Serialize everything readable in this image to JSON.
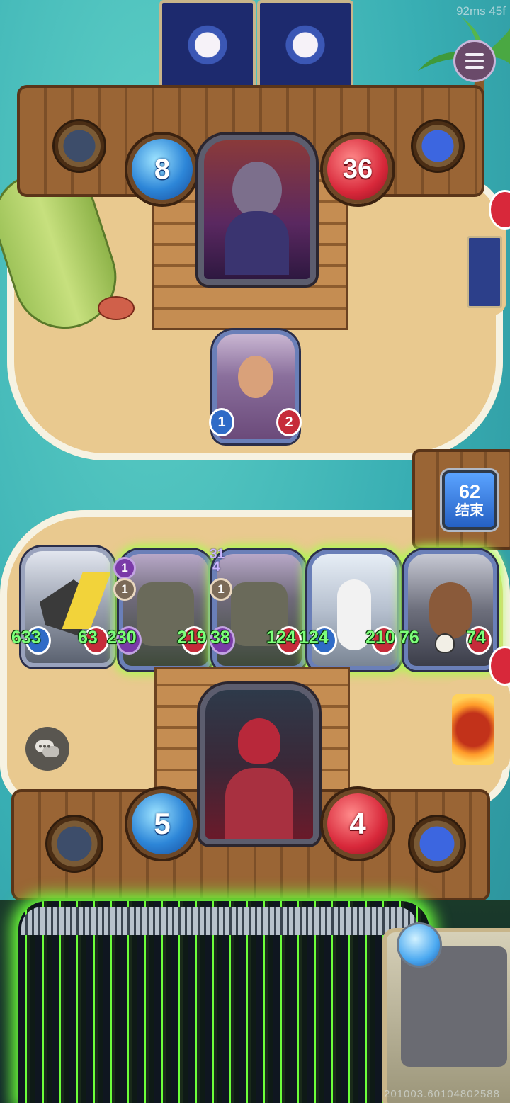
{
  "hud": {
    "debug_text": "92ms 45f",
    "build_text": "201003.60104802588",
    "end_turn": {
      "timer": "62",
      "label": "结束"
    }
  },
  "opponent": {
    "mana": "8",
    "health": "36",
    "minion": {
      "attack": "1",
      "health": "2"
    }
  },
  "player": {
    "mana": "5",
    "health": "4",
    "board": [
      {
        "left_stat": "633",
        "right_stat": "63"
      },
      {
        "badges": [
          "1",
          "1"
        ],
        "left_stat": "230",
        "right_stat": "219"
      },
      {
        "badges": [
          "31",
          "4",
          "1"
        ],
        "left_stat": "38",
        "right_stat": "124"
      },
      {
        "left_stat": "124",
        "right_stat": "210"
      },
      {
        "left_stat": "76",
        "right_stat": "74"
      }
    ]
  },
  "colors": {
    "accent_glow": "#a6ff4a",
    "mana_blue": "#2d86d8",
    "health_red": "#d8283a"
  },
  "icons": [
    "menu-icon",
    "chat-icon",
    "skull-icon",
    "crab-icon",
    "palm-tree-icon",
    "surfboard-icon"
  ]
}
